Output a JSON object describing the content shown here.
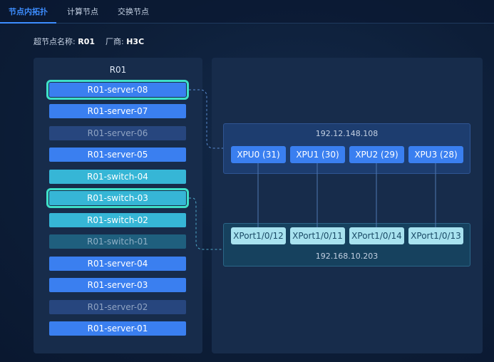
{
  "tabs": [
    {
      "label": "节点内拓扑",
      "active": true
    },
    {
      "label": "计算节点",
      "active": false
    },
    {
      "label": "交换节点",
      "active": false
    }
  ],
  "info": {
    "super_node_label": "超节点名称:",
    "super_node_value": "R01",
    "vendor_label": "厂商:",
    "vendor_value": "H3C"
  },
  "left_panel": {
    "title": "R01",
    "nodes": [
      {
        "label": "R01-server-08",
        "kind": "server",
        "state": "selected"
      },
      {
        "label": "R01-server-07",
        "kind": "server",
        "state": "normal"
      },
      {
        "label": "R01-server-06",
        "kind": "server",
        "state": "disabled"
      },
      {
        "label": "R01-server-05",
        "kind": "server",
        "state": "normal"
      },
      {
        "label": "R01-switch-04",
        "kind": "switch",
        "state": "normal"
      },
      {
        "label": "R01-switch-03",
        "kind": "switch",
        "state": "selected"
      },
      {
        "label": "R01-switch-02",
        "kind": "switch",
        "state": "normal"
      },
      {
        "label": "R01-switch-01",
        "kind": "switch",
        "state": "disabled"
      },
      {
        "label": "R01-server-04",
        "kind": "server",
        "state": "normal"
      },
      {
        "label": "R01-server-03",
        "kind": "server",
        "state": "normal"
      },
      {
        "label": "R01-server-02",
        "kind": "server",
        "state": "disabled"
      },
      {
        "label": "R01-server-01",
        "kind": "server",
        "state": "normal"
      }
    ]
  },
  "xpu_group": {
    "ip": "192.12.148.108",
    "xpus": [
      "XPU0 (31)",
      "XPU1 (30)",
      "XPU2 (29)",
      "XPU3 (28)"
    ]
  },
  "xport_group": {
    "ip": "192.168.10.203",
    "ports": [
      "XPort1/0/12",
      "XPort1/0/11",
      "XPort1/0/14",
      "XPort1/0/13"
    ]
  },
  "colors": {
    "accent": "#3d8dff",
    "server": "#3a7ff0",
    "switch": "#36b6d6",
    "selected_outline": "#3ee0c8",
    "port": "#a8e2ef"
  }
}
